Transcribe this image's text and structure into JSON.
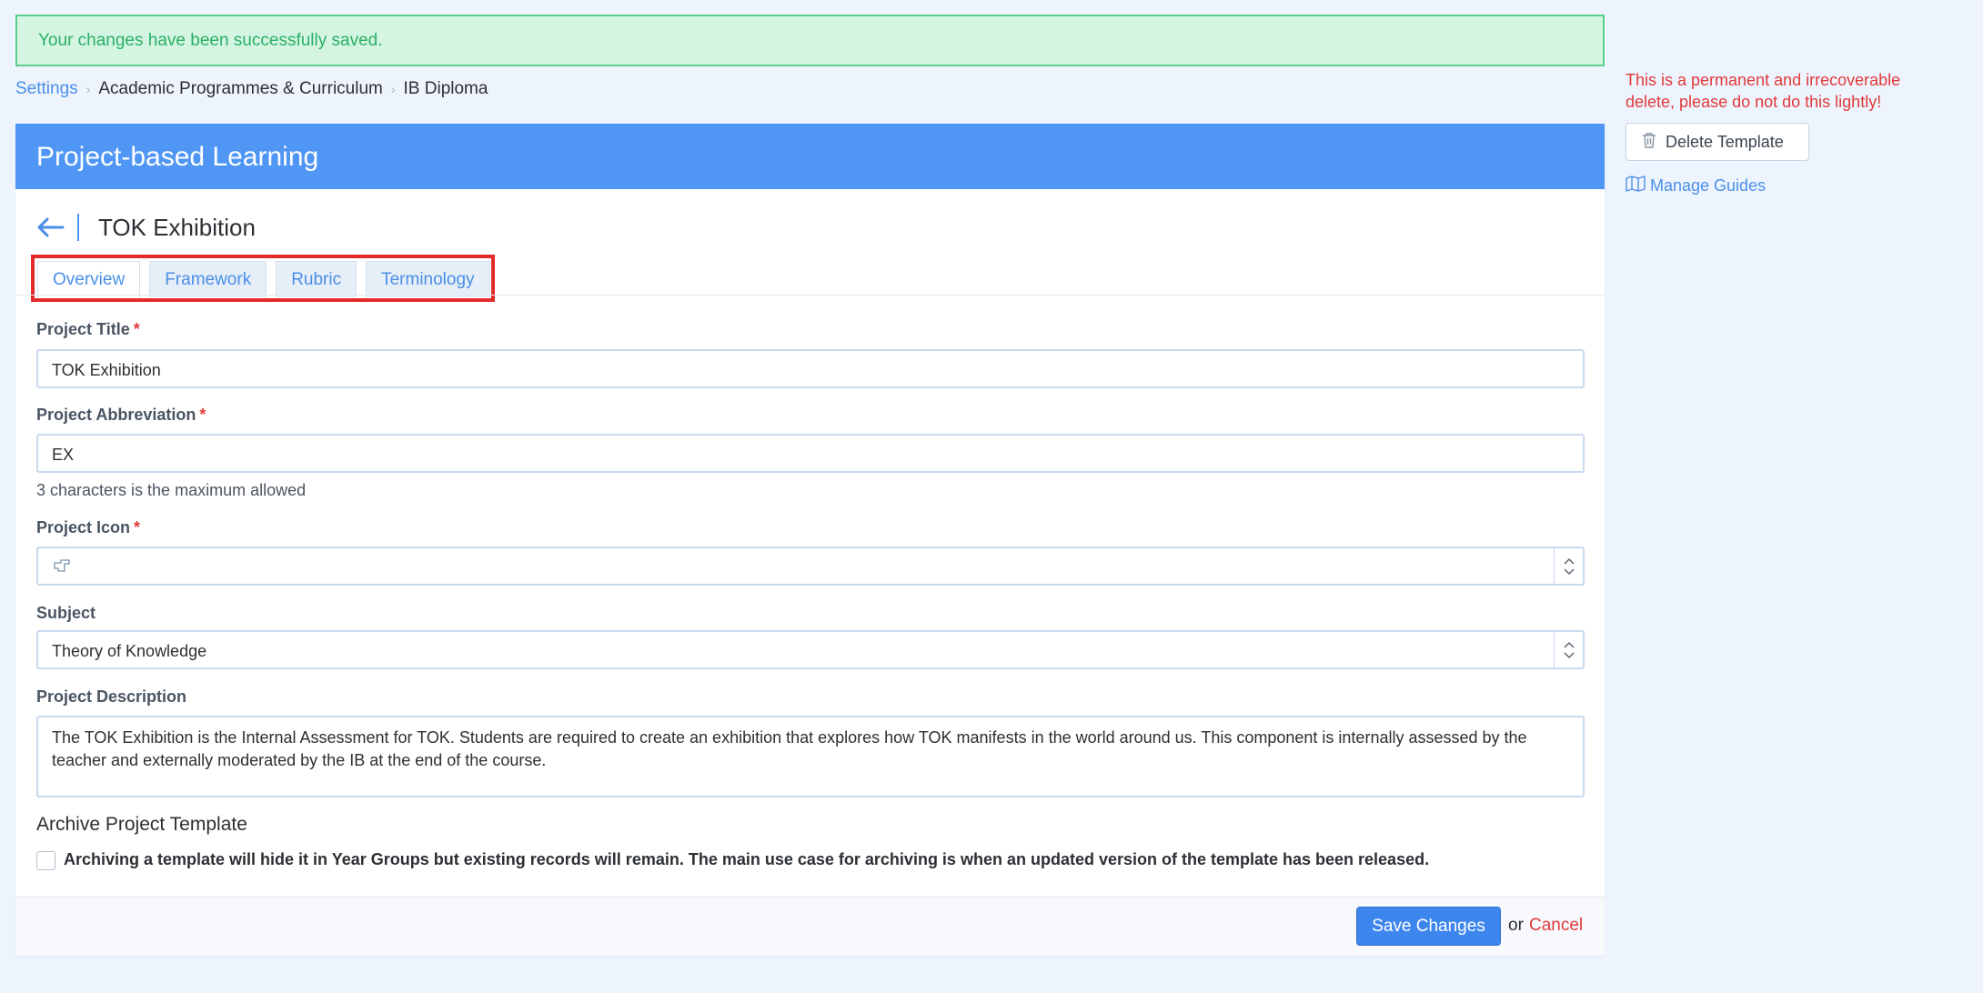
{
  "alert": {
    "text": "Your changes have been successfully saved."
  },
  "breadcrumb": [
    "Settings",
    "Academic Programmes & Curriculum",
    "IB Diploma"
  ],
  "panel": {
    "header": "Project-based Learning",
    "project_name": "TOK Exhibition"
  },
  "tabs": [
    {
      "label": "Overview",
      "active": true
    },
    {
      "label": "Framework",
      "active": false
    },
    {
      "label": "Rubric",
      "active": false
    },
    {
      "label": "Terminology",
      "active": false
    }
  ],
  "form": {
    "project_title": {
      "label": "Project Title",
      "required_mark": "*",
      "value": "TOK Exhibition"
    },
    "project_abbreviation": {
      "label": "Project Abbreviation",
      "required_mark": "*",
      "value": "EX",
      "help": "3 characters is the maximum allowed"
    },
    "project_icon": {
      "label": "Project Icon",
      "required_mark": "*",
      "icon": "pointing-hand-icon"
    },
    "subject": {
      "label": "Subject",
      "value": "Theory of Knowledge"
    },
    "project_description": {
      "label": "Project Description",
      "value": "The TOK Exhibition is the Internal Assessment for TOK. Students are required to create an exhibition that explores how TOK manifests in the world around us. This component is internally assessed by the teacher and externally moderated by the IB at the end of the course."
    },
    "archive": {
      "title": "Archive Project Template",
      "text": "Archiving a template will hide it in Year Groups but existing records will remain. The main use case for archiving is when an updated version of the template has been released.",
      "checked": false
    }
  },
  "footer": {
    "save_label": "Save Changes",
    "or_text": "or",
    "cancel_label": "Cancel"
  },
  "sidebar": {
    "warning": "This is a permanent and irrecoverable delete, please do not do this lightly!",
    "delete_label": "Delete Template",
    "manage_guides_label": "Manage Guides"
  },
  "colors": {
    "primary": "#5096f5",
    "link": "#4a8fe7",
    "danger": "#e03a3a",
    "success_bg": "#d3f5e2",
    "success_text": "#2bb066"
  }
}
